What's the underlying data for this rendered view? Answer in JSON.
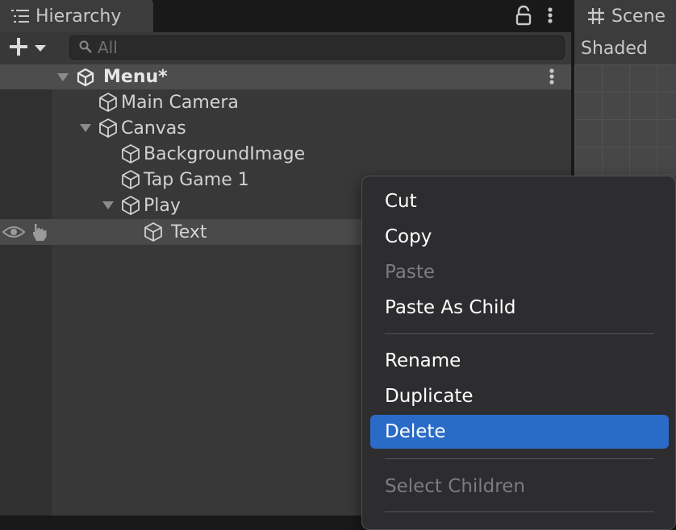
{
  "hierarchy": {
    "tab_title": "Hierarchy",
    "search": {
      "placeholder": "All",
      "value": ""
    },
    "scene": {
      "name": "Menu*"
    },
    "items": [
      {
        "name": "Main Camera"
      },
      {
        "name": "Canvas"
      },
      {
        "name": "BackgroundImage"
      },
      {
        "name": "Tap Game 1"
      },
      {
        "name": "Play"
      },
      {
        "name": "Text"
      }
    ]
  },
  "scene_panel": {
    "tab_title": "Scene",
    "shading_mode": "Shaded"
  },
  "context_menu": {
    "items": [
      {
        "label": "Cut",
        "enabled": true
      },
      {
        "label": "Copy",
        "enabled": true
      },
      {
        "label": "Paste",
        "enabled": false
      },
      {
        "label": "Paste As Child",
        "enabled": true
      },
      {
        "label": "Rename",
        "enabled": true
      },
      {
        "label": "Duplicate",
        "enabled": true
      },
      {
        "label": "Delete",
        "enabled": true,
        "highlighted": true
      },
      {
        "label": "Select Children",
        "enabled": false
      }
    ]
  },
  "colors": {
    "highlight": "#2a6bc8",
    "panel_bg": "#383838",
    "selected_row": "#4a4a4a"
  },
  "icons": [
    "list-icon",
    "lock-icon",
    "kebab-menu-icon",
    "plus-icon",
    "dropdown-arrow-icon",
    "search-icon",
    "unity-logo-icon",
    "gameobject-cube-icon",
    "foldout-arrow-icon",
    "visibility-eye-icon",
    "pickable-hand-icon",
    "grid-icon"
  ]
}
